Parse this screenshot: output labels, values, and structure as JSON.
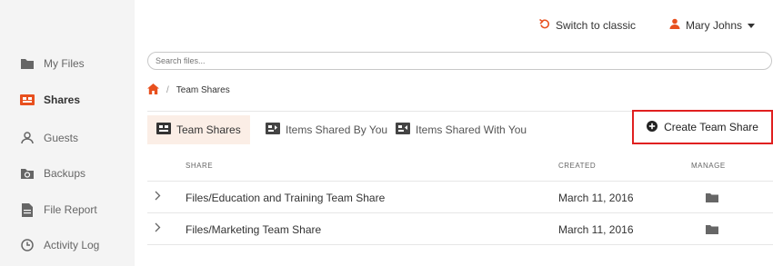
{
  "colors": {
    "accent": "#e8501e",
    "highlight_border": "#e02020",
    "active_tab_bg": "#fbeee6",
    "sidebar_bg": "#f4f4f4"
  },
  "sidebar": {
    "items": [
      {
        "label": "My Files",
        "icon": "folder-icon",
        "active": false
      },
      {
        "label": "Shares",
        "icon": "shares-icon",
        "active": true
      },
      {
        "label": "Guests",
        "icon": "person-icon",
        "active": false
      },
      {
        "label": "Backups",
        "icon": "backup-icon",
        "active": false
      },
      {
        "label": "File Report",
        "icon": "report-icon",
        "active": false
      },
      {
        "label": "Activity Log",
        "icon": "clock-icon",
        "active": false
      }
    ]
  },
  "header": {
    "switch_label": "Switch to classic",
    "user_name": "Mary Johns"
  },
  "search": {
    "placeholder": "Search files..."
  },
  "breadcrumb": {
    "separator": "/",
    "current": "Team Shares"
  },
  "tabs": [
    {
      "label": "Team Shares",
      "active": true
    },
    {
      "label": "Items Shared By You",
      "active": false
    },
    {
      "label": "Items Shared With You",
      "active": false
    }
  ],
  "create_button": {
    "label": "Create Team Share"
  },
  "table": {
    "columns": {
      "share": "SHARE",
      "created": "CREATED",
      "manage": "MANAGE"
    },
    "rows": [
      {
        "share": "Files/Education and Training Team Share",
        "created": "March 11, 2016"
      },
      {
        "share": "Files/Marketing Team Share",
        "created": "March 11, 2016"
      }
    ]
  }
}
